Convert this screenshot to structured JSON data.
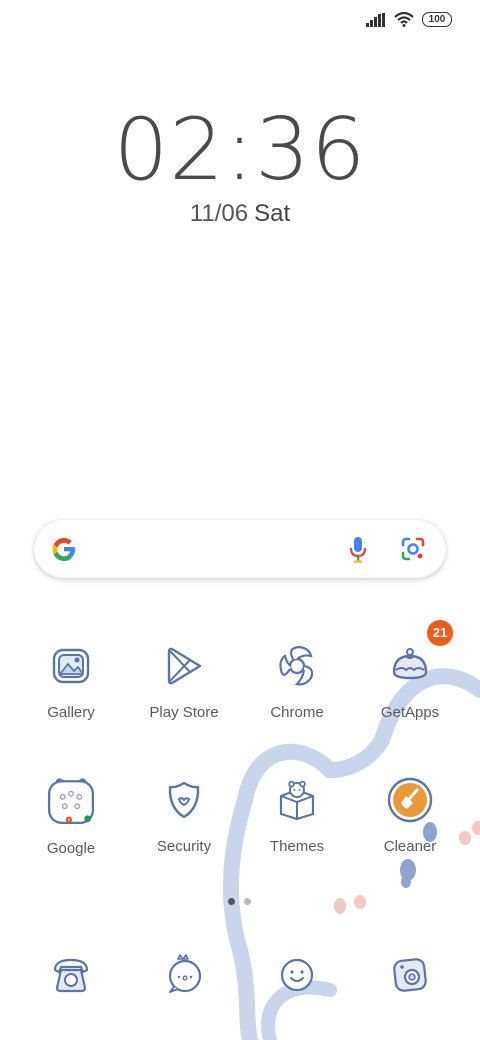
{
  "status_bar": {
    "battery": "100"
  },
  "clock": {
    "time": "02:36",
    "date": "11/06",
    "day": "Sat"
  },
  "apps": {
    "gallery": "Gallery",
    "play_store": "Play Store",
    "chrome": "Chrome",
    "getapps": "GetApps",
    "getapps_badge": "21",
    "google": "Google",
    "security": "Security",
    "themes": "Themes",
    "cleaner": "Cleaner"
  },
  "page_indicator": {
    "pages": 2,
    "current": 1
  },
  "colors": {
    "icon_stroke": "#5b74a8",
    "decor": "#c9d5ea",
    "badge": "#f05a1a",
    "cleaner_orange": "#e99a36"
  }
}
